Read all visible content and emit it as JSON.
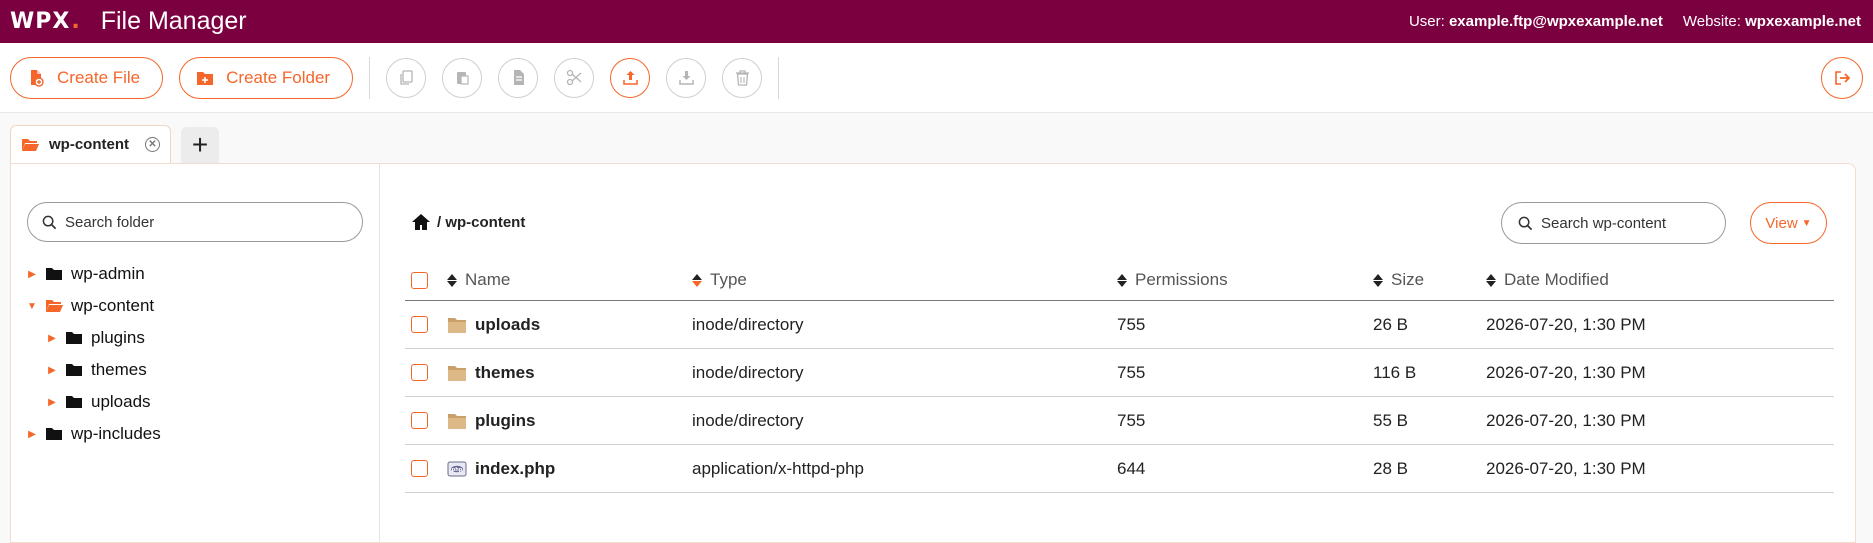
{
  "header": {
    "logo": "WPX",
    "logo_dot": ".",
    "title": "File Manager",
    "user_label": "User:",
    "user_value": "example.ftp@wpxexample.net",
    "website_label": "Website:",
    "website_value": "wpxexample.net"
  },
  "toolbar": {
    "create_file": "Create File",
    "create_folder": "Create Folder",
    "icons": [
      "copy-icon",
      "paste-icon",
      "duplicate-icon",
      "cut-icon",
      "upload-icon",
      "download-icon",
      "trash-icon",
      "logout-icon"
    ],
    "accent": "#f5662a"
  },
  "tabs": [
    {
      "label": "wp-content"
    }
  ],
  "left": {
    "search_placeholder": "Search folder",
    "tree": [
      {
        "label": "wp-admin",
        "expanded": false,
        "depth": 0
      },
      {
        "label": "wp-content",
        "expanded": true,
        "depth": 0
      },
      {
        "label": "plugins",
        "expanded": false,
        "depth": 1
      },
      {
        "label": "themes",
        "expanded": false,
        "depth": 1
      },
      {
        "label": "uploads",
        "expanded": false,
        "depth": 1
      },
      {
        "label": "wp-includes",
        "expanded": false,
        "depth": 0
      }
    ]
  },
  "main": {
    "breadcrumb": "/ wp-content",
    "search_placeholder": "Search wp-content",
    "view_label": "View",
    "columns": {
      "name": "Name",
      "type": "Type",
      "permissions": "Permissions",
      "size": "Size",
      "date": "Date Modified"
    },
    "rows": [
      {
        "name": "uploads",
        "type": "inode/directory",
        "permissions": "755",
        "size": "26 B",
        "date": "2026-07-20, 1:30 PM",
        "kind": "folder"
      },
      {
        "name": "themes",
        "type": "inode/directory",
        "permissions": "755",
        "size": "116 B",
        "date": "2026-07-20, 1:30 PM",
        "kind": "folder"
      },
      {
        "name": "plugins",
        "type": "inode/directory",
        "permissions": "755",
        "size": "55 B",
        "date": "2026-07-20, 1:30 PM",
        "kind": "folder"
      },
      {
        "name": "index.php",
        "type": "application/x-httpd-php",
        "permissions": "644",
        "size": "28 B",
        "date": "2026-07-20, 1:30 PM",
        "kind": "php"
      }
    ]
  },
  "colors": {
    "header_bg": "#7b0040",
    "accent": "#f5662a",
    "folder": "#d8b37a"
  }
}
